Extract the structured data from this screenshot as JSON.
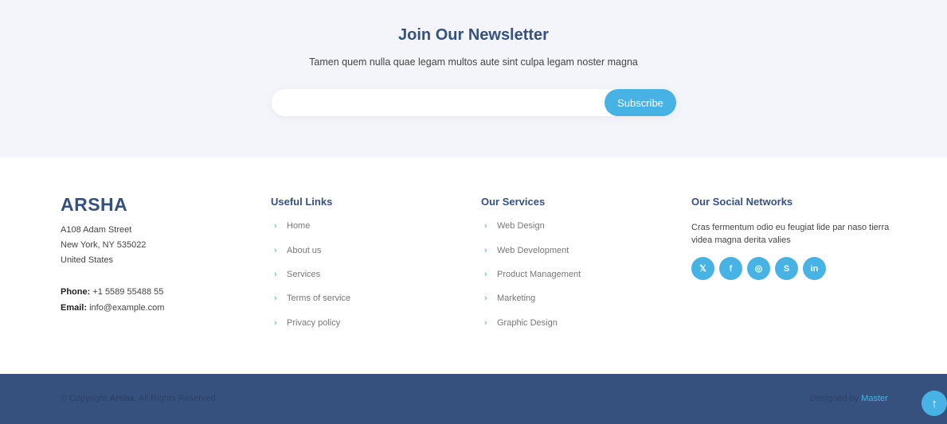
{
  "newsletter": {
    "title": "Join Our Newsletter",
    "text": "Tamen quem nulla quae legam multos aute sint culpa legam noster magna",
    "input_value": "",
    "input_placeholder": "",
    "button_label": "Subscribe"
  },
  "contact": {
    "brand": "ARSHA",
    "address": [
      "A108 Adam Street",
      "New York, NY 535022",
      "United States"
    ],
    "phone_label": "Phone:",
    "phone": "+1 5589 55488 55",
    "email_label": "Email:",
    "email": "info@example.com"
  },
  "useful_links": {
    "title": "Useful Links",
    "items": [
      "Home",
      "About us",
      "Services",
      "Terms of service",
      "Privacy policy"
    ]
  },
  "services": {
    "title": "Our Services",
    "items": [
      "Web Design",
      "Web Development",
      "Product Management",
      "Marketing",
      "Graphic Design"
    ]
  },
  "social": {
    "title": "Our Social Networks",
    "text": "Cras fermentum odio eu feugiat lide par naso tierra videa magna derita valies",
    "icons": [
      {
        "name": "twitter-icon",
        "glyph": "𝕏"
      },
      {
        "name": "facebook-icon",
        "glyph": "f"
      },
      {
        "name": "instagram-icon",
        "glyph": "◎"
      },
      {
        "name": "skype-icon",
        "glyph": "S"
      },
      {
        "name": "linkedin-icon",
        "glyph": "in"
      }
    ]
  },
  "footer_bottom": {
    "copyright_prefix": "© Copyright",
    "copyright_brand": "Arsha",
    "copyright_suffix": ". All Rights Reserved",
    "credits_prefix": "Designed by",
    "credits_link": "Master",
    "back_to_top_glyph": "↑"
  },
  "colors": {
    "accent": "#47b2e4",
    "heading": "#37517e",
    "footer_bg": "#37517e",
    "newsletter_bg": "#f3f5fa"
  }
}
